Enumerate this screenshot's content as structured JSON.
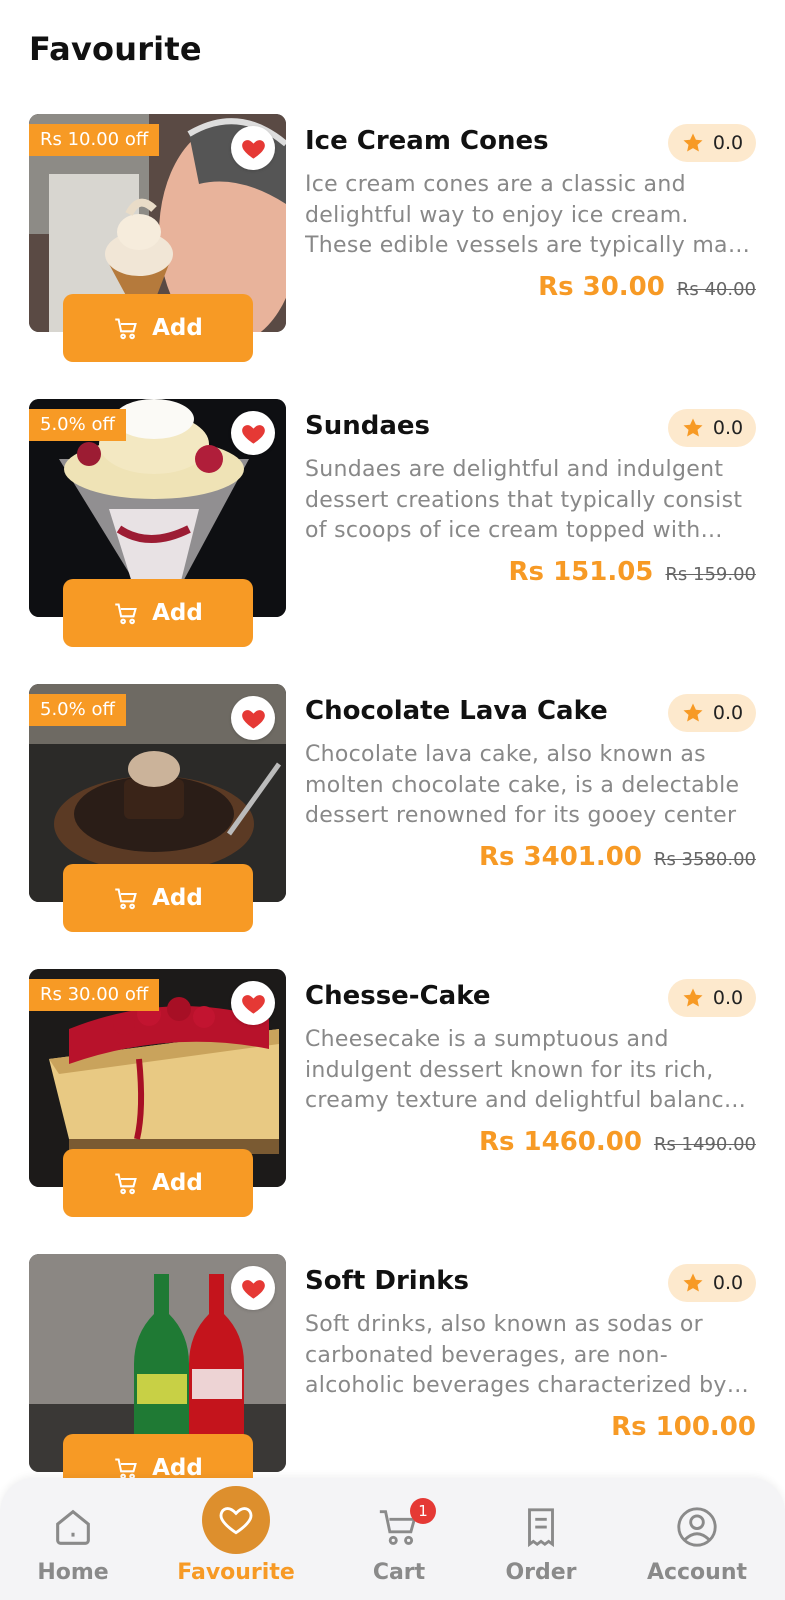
{
  "header": {
    "title": "Favourite"
  },
  "items": [
    {
      "name": "Ice Cream Cones",
      "discount": "Rs 10.00 off",
      "rating": "0.0",
      "description": "Ice cream cones are a classic and delightful way to enjoy ice cream. These edible vessels are typically made of crisp waffle",
      "price": "Rs 30.00",
      "old_price": "Rs 40.00",
      "add_label": "Add"
    },
    {
      "name": "Sundaes",
      "discount": "5.0% off",
      "rating": "0.0",
      "description": "Sundaes are delightful and indulgent dessert creations that typically consist of scoops of ice cream topped with sauces",
      "price": "Rs 151.05",
      "old_price": "Rs 159.00",
      "add_label": "Add"
    },
    {
      "name": "Chocolate Lava Cake",
      "discount": "5.0% off",
      "rating": "0.0",
      "description": "Chocolate lava cake, also known as molten chocolate cake, is a delectable dessert renowned for its gooey center",
      "price": "Rs 3401.00",
      "old_price": "Rs 3580.00",
      "add_label": "Add"
    },
    {
      "name": "Chesse-Cake",
      "discount": "Rs 30.00 off",
      "rating": "0.0",
      "description": "Cheesecake is a sumptuous and indulgent dessert known for its rich, creamy texture and delightful balance of flavors",
      "price": "Rs 1460.00",
      "old_price": "Rs 1490.00",
      "add_label": "Add"
    },
    {
      "name": "Soft Drinks",
      "discount": "",
      "rating": "0.0",
      "description": "Soft drinks, also known as sodas or carbonated beverages, are non-alcoholic beverages characterized by carbonation",
      "price": "Rs 100.00",
      "old_price": "",
      "add_label": "Add"
    }
  ],
  "nav": {
    "home": "Home",
    "favourite": "Favourite",
    "cart": "Cart",
    "cart_count": "1",
    "order": "Order",
    "account": "Account"
  },
  "colors": {
    "accent": "#f79a25",
    "rating_bg": "#fde9cd",
    "heart": "#e53935"
  },
  "icons": [
    "heart-icon",
    "cart-icon",
    "star-icon",
    "home-icon",
    "order-icon",
    "account-icon"
  ]
}
